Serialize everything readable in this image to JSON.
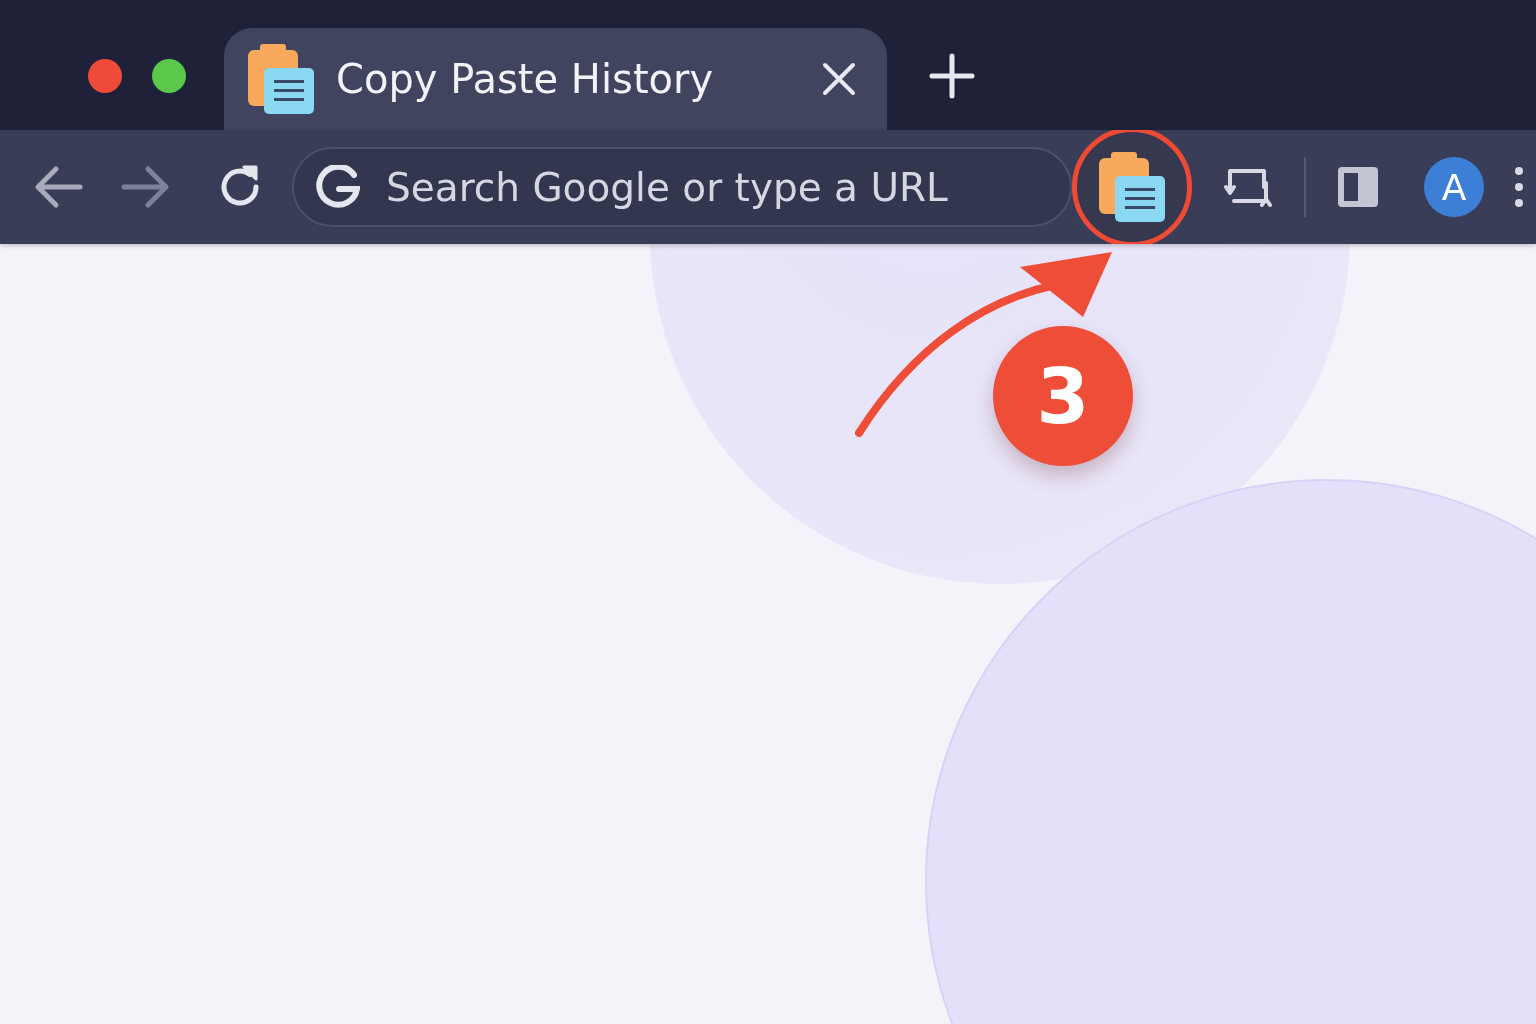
{
  "window_controls": [
    {
      "color": "#f04a3c"
    },
    {
      "color": "#5cc84a"
    }
  ],
  "tab": {
    "title": "Copy Paste History",
    "selected": true
  },
  "address_bar": {
    "placeholder": "Search Google or type a URL"
  },
  "extension": {
    "highlighted": true
  },
  "profile": {
    "initial": "A"
  },
  "callout": {
    "step": "3"
  }
}
